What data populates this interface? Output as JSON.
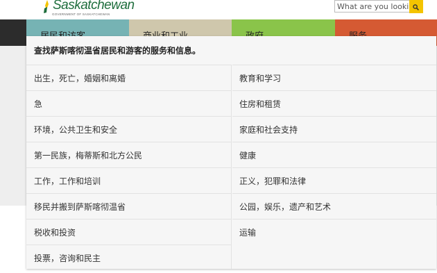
{
  "header": {
    "logo_text": "Saskatchewan",
    "logo_subtext": "GOVERNMENT OF SASKATCHEWAN",
    "search_placeholder": "What are you looking"
  },
  "nav": {
    "tabs": [
      {
        "label": "居民和访客",
        "color": "#76b3b4"
      },
      {
        "label": "商业和工业",
        "color": "#cfc7ac"
      },
      {
        "label": "政府",
        "color": "#8ac44a"
      },
      {
        "label": "服务",
        "color": "#d55a33"
      }
    ]
  },
  "dropdown": {
    "heading": "查找萨斯喀彻温省居民和游客的服务和信息。",
    "left_items": [
      "出生，死亡，婚姻和离婚",
      "急",
      "环境，公共卫生和安全",
      "第一民族，梅蒂斯和北方公民",
      "工作，工作和培训",
      "移民并搬到萨斯喀彻温省",
      "税收和投资",
      "投票，咨询和民主"
    ],
    "right_items": [
      "教育和学习",
      "住房和租赁",
      "家庭和社会支持",
      "健康",
      "正义，犯罪和法律",
      "公园，娱乐，遗产和艺术",
      "运输"
    ]
  },
  "colors": {
    "accent_search": "#f4c400",
    "logo_green": "#1f6e3d"
  }
}
